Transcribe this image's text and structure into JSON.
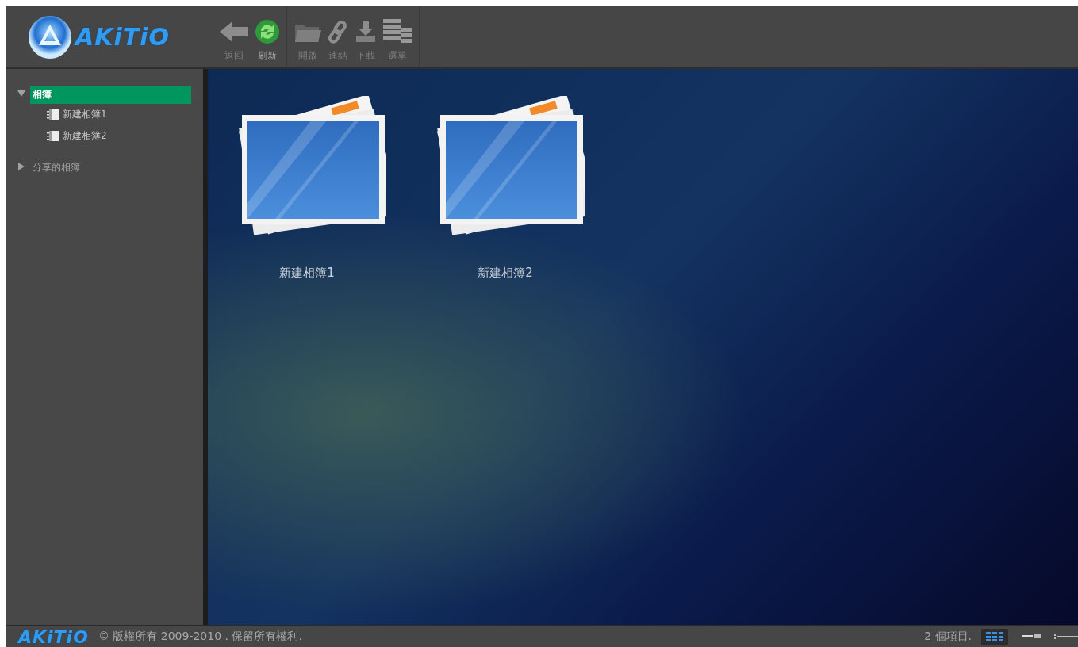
{
  "toolbar": {
    "logo": "AKiTiO",
    "groups": [
      [
        {
          "kind": "back",
          "label": "返回",
          "disabled": true
        },
        {
          "kind": "refresh",
          "label": "刷新",
          "disabled": false
        }
      ],
      [
        {
          "kind": "open",
          "label": "開啟",
          "disabled": true
        },
        {
          "kind": "link",
          "label": "連結",
          "disabled": true
        },
        {
          "kind": "download",
          "label": "下載",
          "disabled": true
        },
        {
          "kind": "menu",
          "label": "選單",
          "disabled": true
        }
      ]
    ]
  },
  "sidebar": {
    "items": [
      {
        "label": "相簿",
        "expanded": true,
        "selected": true,
        "children": [
          {
            "label": "新建相簿1",
            "selected": false
          },
          {
            "label": "新建相簿2",
            "selected": false
          }
        ]
      },
      {
        "label": "分享的相簿",
        "expanded": false,
        "selected": false
      }
    ]
  },
  "albums": [
    {
      "label": "新建相簿1",
      "selected": false
    },
    {
      "label": "新建相簿2",
      "selected": false
    }
  ],
  "status_bar": {
    "logo": "AKiTiO",
    "copyright": "© 版權所有 2009-2010 . 保留所有權利.",
    "count": "2 個項目.",
    "views": [
      {
        "kind": "grid",
        "selected": true
      },
      {
        "kind": "list",
        "selected": false
      }
    ]
  }
}
